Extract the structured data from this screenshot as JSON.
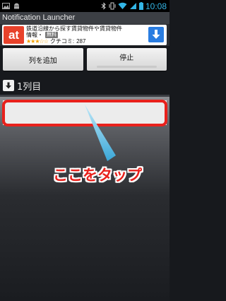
{
  "statusbar": {
    "time": "10:08",
    "icons": [
      "image-icon",
      "android-debug-icon",
      "bluetooth-icon",
      "vibrate-icon",
      "wifi-icon",
      "signal-icon",
      "battery-icon"
    ],
    "accent": "#33b5e5"
  },
  "app": {
    "title": "Notification Launcher"
  },
  "ad": {
    "logo": "at",
    "title": "鉄道沿線から探す賃貸物件や賃貸物件",
    "subtitle": "情報・",
    "badge": "無料",
    "stars": "★★★☆☆",
    "review_label": "クチコミ:",
    "review_count": "287",
    "logo_color": "#e8422b",
    "download_color": "#2a7de1"
  },
  "toolbar": {
    "add_column_label": "列を追加",
    "stop_label": "停止"
  },
  "column": {
    "label": "1列目"
  },
  "annotation": {
    "text": "ここをタップ",
    "color": "#e8211c"
  }
}
